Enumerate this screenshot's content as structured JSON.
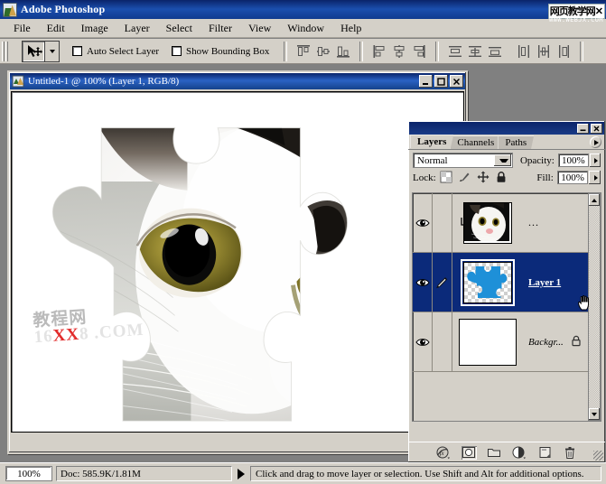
{
  "app": {
    "title": "Adobe Photoshop",
    "icon": "photoshop-icon"
  },
  "watermark_top": {
    "text": "网页教学网",
    "close": "✕",
    "url": "WWW.WEBJX.COM"
  },
  "menubar": {
    "items": [
      {
        "label": "File"
      },
      {
        "label": "Edit"
      },
      {
        "label": "Image"
      },
      {
        "label": "Layer"
      },
      {
        "label": "Select"
      },
      {
        "label": "Filter"
      },
      {
        "label": "View"
      },
      {
        "label": "Window"
      },
      {
        "label": "Help"
      }
    ]
  },
  "options_bar": {
    "tool": "move-tool",
    "auto_select_layer": {
      "label": "Auto Select Layer",
      "checked": false
    },
    "show_bounding_box": {
      "label": "Show Bounding Box",
      "checked": false
    },
    "align_buttons": [
      "align-top-edges",
      "align-vertical-centers",
      "align-bottom-edges",
      "align-left-edges",
      "align-horizontal-centers",
      "align-right-edges"
    ],
    "distribute_buttons": [
      "distribute-top-edges",
      "distribute-vertical-centers",
      "distribute-bottom-edges",
      "distribute-left-edges",
      "distribute-horizontal-centers",
      "distribute-right-edges"
    ]
  },
  "document": {
    "title": "Untitled-1 @ 100% (Layer 1, RGB/8)",
    "minimize": "_",
    "maximize": "□",
    "close": "✕",
    "canvas_watermark": {
      "cn": "教程网",
      "prefix": "16",
      "highlight": "XX",
      "suffix": "8 .COM"
    }
  },
  "layers_panel": {
    "minimize": "─",
    "close": "✕",
    "tabs": [
      {
        "label": "Layers",
        "active": true
      },
      {
        "label": "Channels",
        "active": false
      },
      {
        "label": "Paths",
        "active": false
      }
    ],
    "blend_mode": "Normal",
    "opacity_label": "Opacity:",
    "opacity_value": "100%",
    "lock_label": "Lock:",
    "lock_icons": [
      "lock-transparent-pixels-icon",
      "lock-image-pixels-icon",
      "lock-position-icon",
      "lock-all-icon"
    ],
    "fill_label": "Fill:",
    "fill_value": "100%",
    "layers": [
      {
        "name": "...",
        "visible": true,
        "selected": false,
        "thumbnail": "cat-photo",
        "clipped": true,
        "italic": false,
        "locked": false,
        "link_icon": ""
      },
      {
        "name": "Layer 1",
        "visible": true,
        "selected": true,
        "thumbnail": "puzzle-piece",
        "clipped": false,
        "italic": false,
        "locked": false,
        "link_icon": "pencil-icon"
      },
      {
        "name": "Backgr...",
        "visible": true,
        "selected": false,
        "thumbnail": "white-blank",
        "clipped": false,
        "italic": true,
        "locked": true,
        "link_icon": ""
      }
    ],
    "bottom_buttons": [
      {
        "name": "layer-style-button",
        "glyph": "fx"
      },
      {
        "name": "add-layer-mask-button",
        "glyph": "mask"
      },
      {
        "name": "new-group-button",
        "glyph": "folder"
      },
      {
        "name": "new-adjustment-layer-button",
        "glyph": "half-circle"
      },
      {
        "name": "new-layer-button",
        "glyph": "page"
      },
      {
        "name": "delete-layer-button",
        "glyph": "trash"
      }
    ]
  },
  "status_bar": {
    "zoom": "100%",
    "doc_info": "Doc: 585.9K/1.81M",
    "message": "Click and drag to move layer or selection. Use Shift and Alt for additional options."
  },
  "colors": {
    "chrome": "#d4d0c8",
    "title_blue": "#0a246a",
    "selection_blue": "#0b2a7a",
    "desktop_gray": "#808080",
    "puzzle_blue": "#1e90d8"
  }
}
